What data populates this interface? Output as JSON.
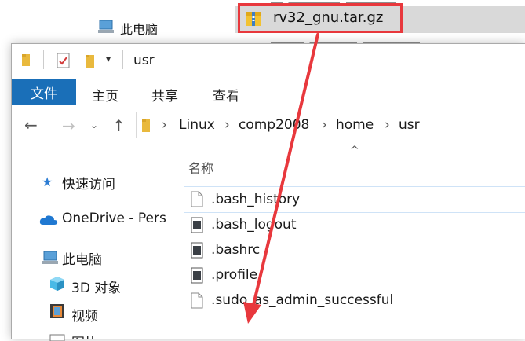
{
  "background_window": {
    "nav_label": "此电脑",
    "files": {
      "selected_file": "rv32_gnu.tar.gz"
    }
  },
  "window": {
    "title": "usr",
    "ribbon_tabs": {
      "file": "文件",
      "home": "主页",
      "share": "共享",
      "view": "查看"
    },
    "address": {
      "crumbs": [
        "Linux",
        "comp2008",
        "home",
        "usr"
      ]
    },
    "nav_pane": {
      "quick_access": "快速访问",
      "onedrive": "OneDrive - Pers",
      "this_pc": "此电脑",
      "objects_3d": "3D 对象",
      "videos": "视频",
      "pictures": "图片"
    },
    "content": {
      "column_name": "名称",
      "files": [
        ".bash_history",
        ".bash_logout",
        ".bashrc",
        ".profile",
        ".sudo_as_admin_successful"
      ]
    }
  },
  "annotation": {
    "highlight_color": "#e8383d"
  },
  "colors": {
    "accent": "#1a6fb8"
  }
}
